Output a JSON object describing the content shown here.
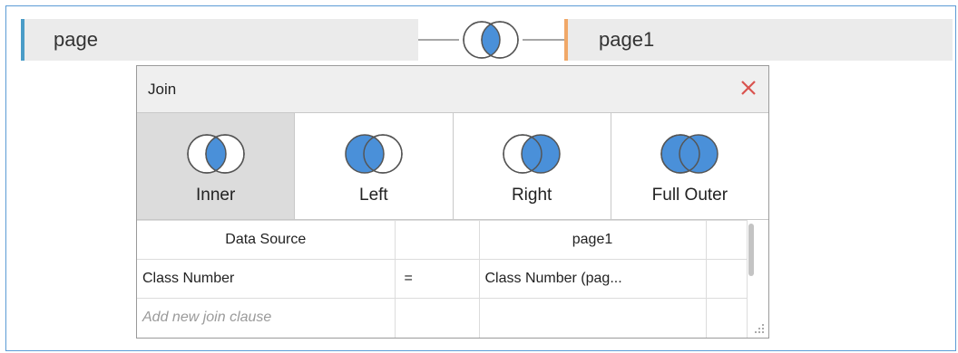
{
  "left_table": {
    "name": "page"
  },
  "right_table": {
    "name": "page1"
  },
  "dialog": {
    "title": "Join",
    "join_types": [
      {
        "label": "Inner",
        "icon": "inner-join-icon",
        "selected": true
      },
      {
        "label": "Left",
        "icon": "left-join-icon",
        "selected": false
      },
      {
        "label": "Right",
        "icon": "right-join-icon",
        "selected": false
      },
      {
        "label": "Full Outer",
        "icon": "full-outer-join-icon",
        "selected": false
      }
    ],
    "clause_table": {
      "header_left": "Data Source",
      "header_op": "",
      "header_right": "page1",
      "rows": [
        {
          "left": "Class Number",
          "op": "=",
          "right": "Class Number (pag..."
        }
      ],
      "add_placeholder": "Add new join clause"
    }
  },
  "colors": {
    "accent_blue": "#4a90d9",
    "left_bar": "#4a9cc7",
    "right_bar": "#f0a868",
    "close_red": "#d9534f"
  }
}
